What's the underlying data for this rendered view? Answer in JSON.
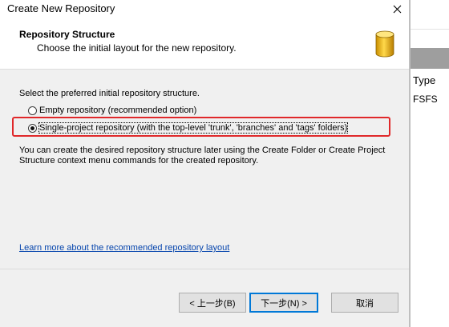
{
  "dialog": {
    "title": "Create New Repository",
    "close_glyph": "✕",
    "header": {
      "title": "Repository Structure",
      "subtitle": "Choose the initial layout for the new repository."
    },
    "instruction": "Select the preferred initial repository structure.",
    "options": [
      {
        "label": "Empty repository (recommended option)",
        "selected": false
      },
      {
        "label": "Single-project repository (with the top-level 'trunk', 'branches' and 'tags' folders)",
        "selected": true
      }
    ],
    "info_text": "You can create the desired repository structure later using the Create Folder or Create Project Structure context menu commands for the created repository.",
    "learn_more_link": "Learn more about the recommended repository layout",
    "buttons": {
      "back": "< 上一步(B)",
      "next": "下一步(N) >",
      "cancel": "取消"
    }
  },
  "background_window": {
    "column_header": "Type",
    "cell_value": "FSFS"
  },
  "colors": {
    "highlight": "#e0282a",
    "link": "#0645ad",
    "default_button_border": "#0078d7",
    "icon_gold": "#e8b10a"
  },
  "icons": {
    "header_icon": "database-icon",
    "close_icon": "close-icon"
  }
}
